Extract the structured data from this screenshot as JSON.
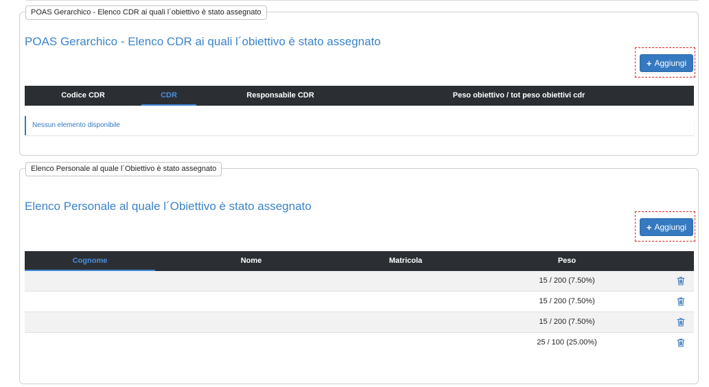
{
  "colors": {
    "accent": "#3b83c9",
    "button": "#3579c0",
    "header_bg": "#2b2f33",
    "dashed_highlight": "#e02020"
  },
  "section1": {
    "legend": "POAS Gerarchico - Elenco CDR ai quali l´obiettivo è stato assegnato",
    "title": "POAS Gerarchico - Elenco CDR ai quali l´obiettivo è stato assegnato",
    "add_label": "Aggiungi",
    "add_icon": "plus-icon",
    "columns": [
      "Codice CDR",
      "CDR",
      "Responsabile CDR",
      "Peso obiettivo / tot peso obiettivi cdr"
    ],
    "sorted_column": "CDR",
    "empty_text": "Nessun elemento disponibile"
  },
  "section2": {
    "legend": "Elenco Personale al quale l´Obiettivo è stato assegnato",
    "title": "Elenco Personale al quale l´Obiettivo è stato assegnato",
    "add_label": "Aggiungi",
    "add_icon": "plus-icon",
    "columns": [
      "Cognome",
      "Nome",
      "Matricola",
      "Peso"
    ],
    "sorted_column": "Cognome",
    "rows": [
      {
        "cognome": "",
        "nome": "",
        "matricola": "",
        "peso": "15 / 200 (7.50%)"
      },
      {
        "cognome": "",
        "nome": "",
        "matricola": "",
        "peso": "15 / 200 (7.50%)"
      },
      {
        "cognome": "",
        "nome": "",
        "matricola": "",
        "peso": "15 / 200 (7.50%)"
      },
      {
        "cognome": "",
        "nome": "",
        "matricola": "",
        "peso": "25 / 100 (25.00%)"
      }
    ],
    "row_action_icon": "trash-icon"
  }
}
